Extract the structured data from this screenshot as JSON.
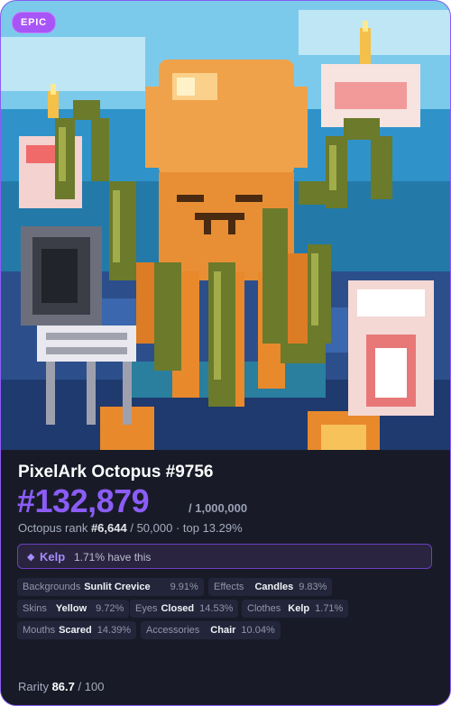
{
  "badge": "EPIC",
  "title": "PixelArk Octopus #9756",
  "rank_number": "#132,879",
  "total": "/ 1,000,000",
  "octopus_rank": {
    "label": "Octopus rank",
    "value": "#6,644",
    "rest": "/ 50,000 · top 13.29%"
  },
  "highlight_trait": {
    "name": "Kelp",
    "pct": "1.71% have this",
    "icon": "diamond-icon"
  },
  "traits": [
    {
      "key": "Backgrounds",
      "value": "Sunlit Crevice",
      "pct": "9.91%"
    },
    {
      "key": "Effects",
      "value": "Candles",
      "pct": "9.83%"
    },
    {
      "key": "Skins",
      "value": "Yellow",
      "pct": "9.72%"
    },
    {
      "key": "Eyes",
      "value": "Closed",
      "pct": "14.53%"
    },
    {
      "key": "Clothes",
      "value": "Kelp",
      "pct": "1.71%"
    },
    {
      "key": "Mouths",
      "value": "Scared",
      "pct": "14.39%"
    },
    {
      "key": "Accessories",
      "value": "Chair",
      "pct": "10.04%"
    }
  ],
  "rarity": {
    "label": "Rarity",
    "value": "86.7",
    "max": "/ 100"
  },
  "colors": {
    "accent": "#8b5cf6",
    "card_bg": "#181b27",
    "sky": "#3ba6dc",
    "octopus": "#f0a24a",
    "kelp": "#6b7a2b"
  }
}
